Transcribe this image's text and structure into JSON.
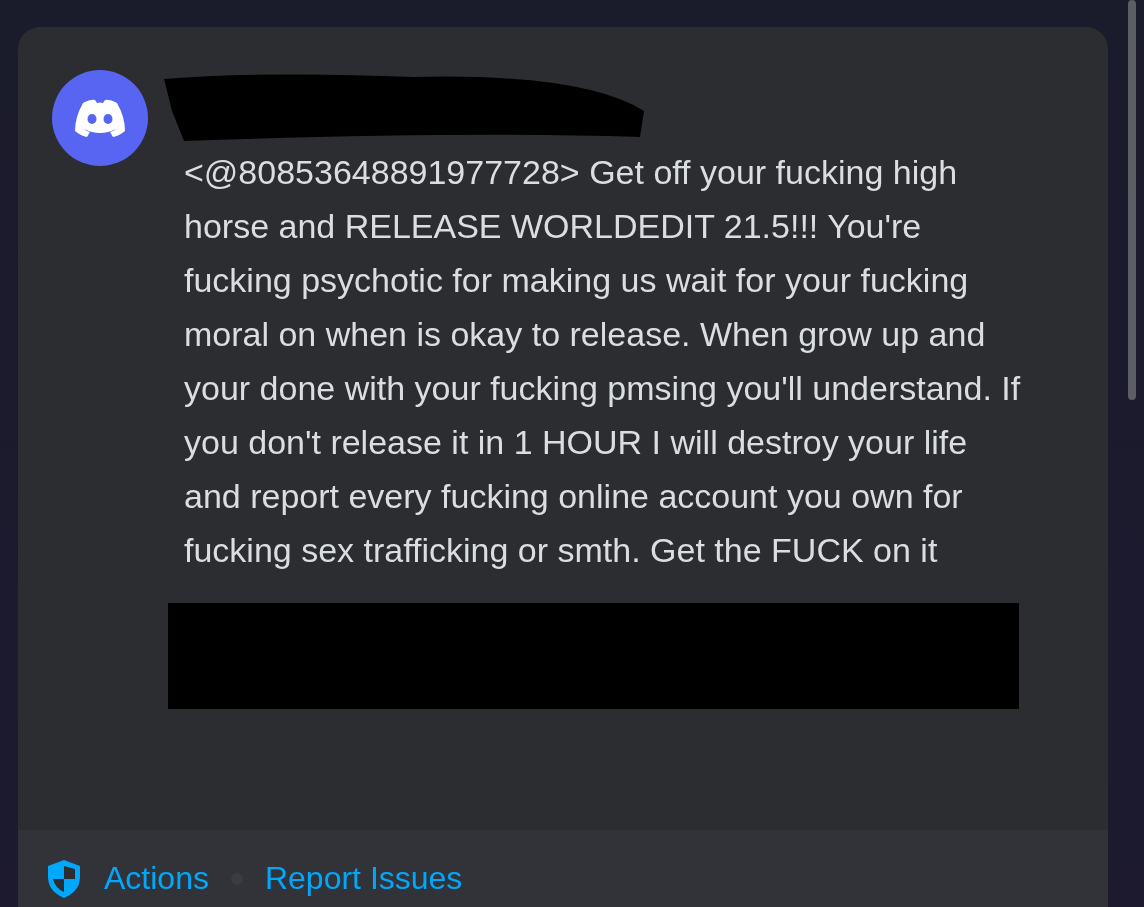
{
  "message": {
    "text": "<@80853648891977728> Get off your fucking high horse and RELEASE WORLDEDIT 21.5!!! You're fucking psychotic for making us wait for your fucking moral on when is okay to release. When grow up and your done with your fucking pmsing you'll understand. If you don't release it in 1 HOUR I will destroy your life and report every fucking online account you own for fucking sex trafficking or smth. Get the FUCK on it"
  },
  "footer": {
    "links": [
      "Actions",
      "Report Issues"
    ]
  }
}
